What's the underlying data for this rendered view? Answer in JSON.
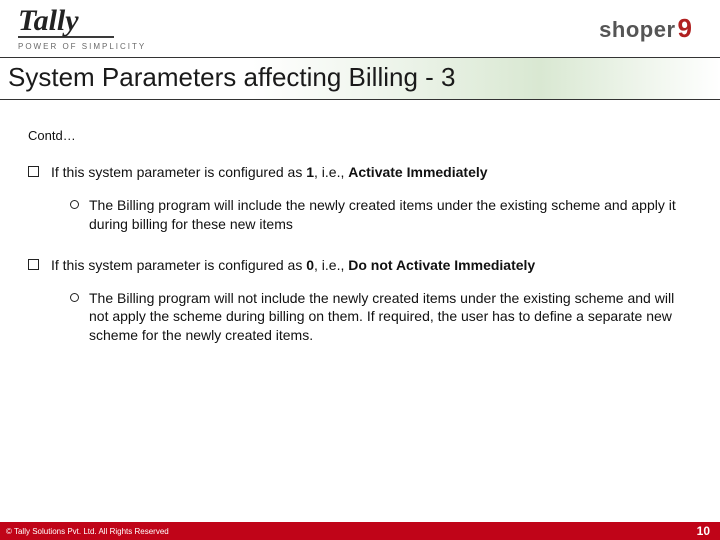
{
  "header": {
    "tally_name": "Tally",
    "tally_tagline": "POWER OF SIMPLICITY",
    "shoper_text": "shoper",
    "shoper_nine": "9"
  },
  "title": "System Parameters affecting Billing - 3",
  "contd": "Contd…",
  "bullets": [
    {
      "pre": "If this system parameter is configured as ",
      "bold1": "1",
      "mid": ", i.e., ",
      "bold2": "Activate Immediately",
      "sub": "The Billing program will include the newly created items under the existing scheme and apply it during billing for these new items"
    },
    {
      "pre": "If this system parameter is configured as ",
      "bold1": "0",
      "mid": ", i.e., ",
      "bold2": "Do not Activate Immediately",
      "sub": "The Billing program will not include the newly created items under the existing scheme and will not apply the scheme during billing on them. If required, the user has to define a separate new scheme for the newly created items."
    }
  ],
  "footer": {
    "copyright": "© Tally Solutions Pvt. Ltd. All Rights Reserved",
    "page": "10"
  },
  "colors": {
    "footer_bg": "#c00418",
    "shoper_nine": "#b02020"
  }
}
